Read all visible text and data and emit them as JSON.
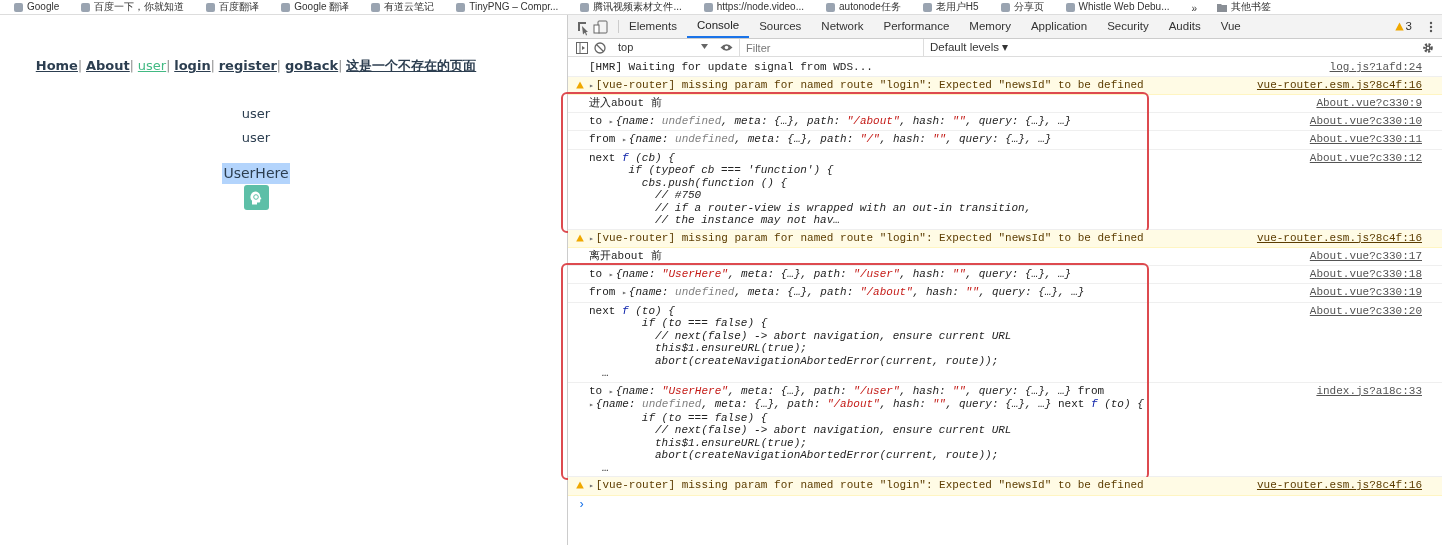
{
  "bookmarks": [
    {
      "label": "Google"
    },
    {
      "label": "百度一下，你就知道"
    },
    {
      "label": "百度翻译"
    },
    {
      "label": "Google 翻译"
    },
    {
      "label": "有道云笔记"
    },
    {
      "label": "TinyPNG – Compr..."
    },
    {
      "label": "腾讯视频素材文件..."
    },
    {
      "label": "https://node.video..."
    },
    {
      "label": "autonode任务"
    },
    {
      "label": "老用户H5"
    },
    {
      "label": "分享页"
    },
    {
      "label": "Whistle Web Debu..."
    }
  ],
  "bookmarks_more": "»",
  "bookmarks_other": "其他书签",
  "app": {
    "nav": [
      {
        "label": "Home",
        "selected": false,
        "separator": "|"
      },
      {
        "label": "About",
        "selected": false,
        "separator": "|"
      },
      {
        "label": "user",
        "selected": true,
        "separator": "|"
      },
      {
        "label": "login",
        "selected": false,
        "separator": "|"
      },
      {
        "label": "register",
        "selected": false,
        "separator": "|"
      },
      {
        "label": "goBack",
        "selected": false,
        "separator": "|"
      },
      {
        "label": "这是一个不存在的页面",
        "selected": false
      }
    ],
    "texts": [
      "user",
      "user"
    ],
    "heading": {
      "text": "UserHere",
      "selected": true
    }
  },
  "devtools": {
    "tabs": [
      {
        "label": "Elements",
        "selected": false
      },
      {
        "label": "Console",
        "selected": true
      },
      {
        "label": "Sources",
        "selected": false
      },
      {
        "label": "Network",
        "selected": false
      },
      {
        "label": "Performance",
        "selected": false
      },
      {
        "label": "Memory",
        "selected": false
      },
      {
        "label": "Application",
        "selected": false
      },
      {
        "label": "Security",
        "selected": false
      },
      {
        "label": "Audits",
        "selected": false
      },
      {
        "label": "Vue",
        "selected": false
      }
    ],
    "warning_count": "3",
    "context": "top",
    "filter": {
      "placeholder": "Filter"
    },
    "levels": "Default levels ▾",
    "console": [
      {
        "outlined": false,
        "messages": [
          {
            "kind": "log",
            "source": "log.js?1afd:24",
            "lines": [
              [
                {
                  "kind": "plain",
                  "text": "[HMR] Waiting for update signal from WDS..."
                }
              ]
            ]
          },
          {
            "kind": "warn",
            "source": "vue-router.esm.js?8c4f:16",
            "lines": [
              [
                {
                  "kind": "tri",
                  "text": "▸"
                },
                {
                  "kind": "plain",
                  "text": "[vue-router] missing param for named route \"login\": Expected \"newsId\" to be defined"
                }
              ]
            ]
          }
        ]
      },
      {
        "outlined": true,
        "messages": [
          {
            "kind": "log",
            "source": "About.vue?c330:9",
            "lines": [
              [
                {
                  "kind": "plain",
                  "text": "进入about 前"
                }
              ]
            ]
          },
          {
            "kind": "log",
            "source": "About.vue?c330:10",
            "lines": [
              [
                {
                  "kind": "plain",
                  "text": "to "
                },
                {
                  "kind": "tri",
                  "text": "▸"
                },
                {
                  "kind": "obj",
                  "text": "{name: "
                },
                {
                  "kind": "undef",
                  "text": "undefined"
                },
                {
                  "kind": "obj",
                  "text": ", meta: {…}, path: "
                },
                {
                  "kind": "str",
                  "text": "\"/about\""
                },
                {
                  "kind": "obj",
                  "text": ", hash: "
                },
                {
                  "kind": "str",
                  "text": "\"\""
                },
                {
                  "kind": "obj",
                  "text": ", query: {…}, …}"
                }
              ]
            ]
          },
          {
            "kind": "log",
            "source": "About.vue?c330:11",
            "lines": [
              [
                {
                  "kind": "plain",
                  "text": "from "
                },
                {
                  "kind": "tri",
                  "text": "▸"
                },
                {
                  "kind": "obj",
                  "text": "{name: "
                },
                {
                  "kind": "undef",
                  "text": "undefined"
                },
                {
                  "kind": "obj",
                  "text": ", meta: {…}, path: "
                },
                {
                  "kind": "str",
                  "text": "\"/\""
                },
                {
                  "kind": "obj",
                  "text": ", hash: "
                },
                {
                  "kind": "str",
                  "text": "\"\""
                },
                {
                  "kind": "obj",
                  "text": ", query: {…}, …}"
                }
              ]
            ]
          },
          {
            "kind": "log",
            "source": "About.vue?c330:12",
            "lines": [
              [
                {
                  "kind": "plain",
                  "text": "next "
                },
                {
                  "kind": "fn",
                  "text": "f"
                },
                {
                  "kind": "obj",
                  "text": " (cb) {"
                }
              ],
              [
                {
                  "kind": "obj",
                  "text": "      if (typeof cb === 'function') {"
                }
              ],
              [
                {
                  "kind": "obj",
                  "text": "        cbs.push(function () {"
                }
              ],
              [
                {
                  "kind": "obj",
                  "text": "          // #750"
                }
              ],
              [
                {
                  "kind": "obj",
                  "text": "          // if a router-view is wrapped with an out-in transition,"
                }
              ],
              [
                {
                  "kind": "obj",
                  "text": "          // the instance may not hav…"
                }
              ]
            ]
          }
        ]
      },
      {
        "outlined": false,
        "messages": [
          {
            "kind": "warn",
            "source": "vue-router.esm.js?8c4f:16",
            "lines": [
              [
                {
                  "kind": "tri",
                  "text": "▸"
                },
                {
                  "kind": "plain",
                  "text": "[vue-router] missing param for named route \"login\": Expected \"newsId\" to be defined"
                }
              ]
            ]
          },
          {
            "kind": "log",
            "source": "About.vue?c330:17",
            "lines": [
              [
                {
                  "kind": "plain",
                  "text": "离开about 前"
                }
              ]
            ]
          }
        ]
      },
      {
        "outlined": true,
        "messages": [
          {
            "kind": "log",
            "source": "About.vue?c330:18",
            "lines": [
              [
                {
                  "kind": "plain",
                  "text": "to "
                },
                {
                  "kind": "tri",
                  "text": "▸"
                },
                {
                  "kind": "obj",
                  "text": "{name: "
                },
                {
                  "kind": "str",
                  "text": "\"UserHere\""
                },
                {
                  "kind": "obj",
                  "text": ", meta: {…}, path: "
                },
                {
                  "kind": "str",
                  "text": "\"/user\""
                },
                {
                  "kind": "obj",
                  "text": ", hash: "
                },
                {
                  "kind": "str",
                  "text": "\"\""
                },
                {
                  "kind": "obj",
                  "text": ", query: {…}, …}"
                }
              ]
            ]
          },
          {
            "kind": "log",
            "source": "About.vue?c330:19",
            "lines": [
              [
                {
                  "kind": "plain",
                  "text": "from "
                },
                {
                  "kind": "tri",
                  "text": "▸"
                },
                {
                  "kind": "obj",
                  "text": "{name: "
                },
                {
                  "kind": "undef",
                  "text": "undefined"
                },
                {
                  "kind": "obj",
                  "text": ", meta: {…}, path: "
                },
                {
                  "kind": "str",
                  "text": "\"/about\""
                },
                {
                  "kind": "obj",
                  "text": ", hash: "
                },
                {
                  "kind": "str",
                  "text": "\"\""
                },
                {
                  "kind": "obj",
                  "text": ", query: {…}, …}"
                }
              ]
            ]
          },
          {
            "kind": "log",
            "source": "About.vue?c330:20",
            "lines": [
              [
                {
                  "kind": "plain",
                  "text": "next "
                },
                {
                  "kind": "fn",
                  "text": "f"
                },
                {
                  "kind": "obj",
                  "text": " (to) {"
                }
              ],
              [
                {
                  "kind": "obj",
                  "text": "        if (to === false) {"
                }
              ],
              [
                {
                  "kind": "obj",
                  "text": "          // next(false) -> abort navigation, ensure current URL"
                }
              ],
              [
                {
                  "kind": "obj",
                  "text": "          this$1.ensureURL(true);"
                }
              ],
              [
                {
                  "kind": "obj",
                  "text": "          abort(createNavigationAbortedError(current, route));"
                }
              ],
              [
                {
                  "kind": "obj",
                  "text": "  …"
                }
              ]
            ]
          },
          {
            "kind": "log",
            "source": "index.js?a18c:33",
            "lines": [
              [
                {
                  "kind": "plain",
                  "text": "to "
                },
                {
                  "kind": "tri",
                  "text": "▸"
                },
                {
                  "kind": "obj",
                  "text": "{name: "
                },
                {
                  "kind": "str",
                  "text": "\"UserHere\""
                },
                {
                  "kind": "obj",
                  "text": ", meta: {…}, path: "
                },
                {
                  "kind": "str",
                  "text": "\"/user\""
                },
                {
                  "kind": "obj",
                  "text": ", hash: "
                },
                {
                  "kind": "str",
                  "text": "\"\""
                },
                {
                  "kind": "obj",
                  "text": ", query: {…}, …}"
                },
                {
                  "kind": "plain",
                  "text": " from"
                }
              ],
              [
                {
                  "kind": "tri",
                  "text": "▸"
                },
                {
                  "kind": "obj",
                  "text": "{name: "
                },
                {
                  "kind": "undef",
                  "text": "undefined"
                },
                {
                  "kind": "obj",
                  "text": ", meta: {…}, path: "
                },
                {
                  "kind": "str",
                  "text": "\"/about\""
                },
                {
                  "kind": "obj",
                  "text": ", hash: "
                },
                {
                  "kind": "str",
                  "text": "\"\""
                },
                {
                  "kind": "obj",
                  "text": ", query: {…}, …}"
                },
                {
                  "kind": "plain",
                  "text": " next "
                },
                {
                  "kind": "fn",
                  "text": "f"
                },
                {
                  "kind": "obj",
                  "text": " (to) {"
                }
              ],
              [
                {
                  "kind": "obj",
                  "text": "        if (to === false) {"
                }
              ],
              [
                {
                  "kind": "obj",
                  "text": "          // next(false) -> abort navigation, ensure current URL"
                }
              ],
              [
                {
                  "kind": "obj",
                  "text": "          this$1.ensureURL(true);"
                }
              ],
              [
                {
                  "kind": "obj",
                  "text": "          abort(createNavigationAbortedError(current, route));"
                }
              ],
              [
                {
                  "kind": "obj",
                  "text": "  …"
                }
              ]
            ]
          }
        ]
      },
      {
        "outlined": false,
        "messages": [
          {
            "kind": "warn",
            "source": "vue-router.esm.js?8c4f:16",
            "lines": [
              [
                {
                  "kind": "tri",
                  "text": "▸"
                },
                {
                  "kind": "plain",
                  "text": "[vue-router] missing param for named route \"login\": Expected \"newsId\" to be defined"
                }
              ]
            ]
          }
        ]
      }
    ],
    "prompt": "›"
  }
}
